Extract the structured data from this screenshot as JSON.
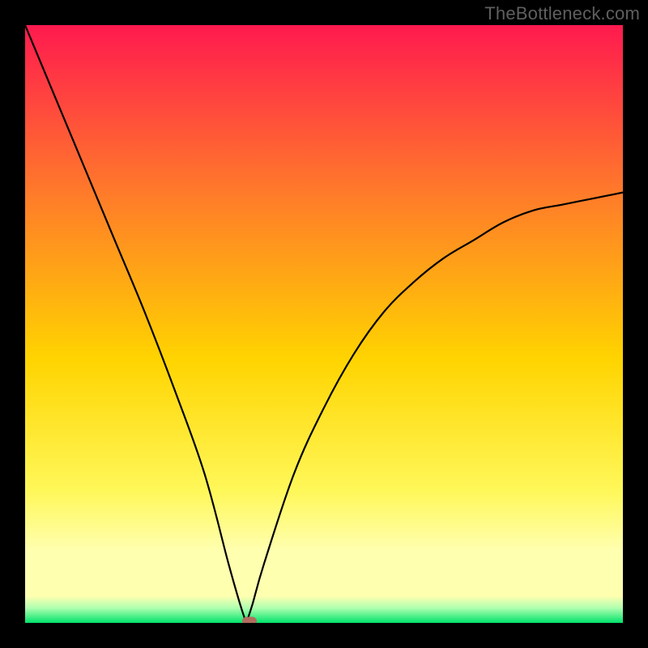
{
  "watermark": {
    "text": "TheBottleneck.com"
  },
  "colors": {
    "top": "#ff1a4f",
    "mid1": "#ff7a2a",
    "mid2": "#ffd400",
    "mid3": "#fff85a",
    "paleyellow": "#ffffb0",
    "palegreen": "#b0ffb0",
    "bottom": "#00e36b",
    "curve": "#000000",
    "marker": "#b36b5e"
  },
  "gradient_stops": [
    {
      "offset": 0.0,
      "key": "top"
    },
    {
      "offset": 0.28,
      "key": "mid1"
    },
    {
      "offset": 0.56,
      "key": "mid2"
    },
    {
      "offset": 0.78,
      "key": "mid3"
    },
    {
      "offset": 0.88,
      "key": "paleyellow"
    },
    {
      "offset": 0.955,
      "key": "paleyellow"
    },
    {
      "offset": 0.975,
      "key": "palegreen"
    },
    {
      "offset": 1.0,
      "key": "bottom"
    }
  ],
  "chart_data": {
    "type": "line",
    "title": "",
    "xlabel": "",
    "ylabel": "",
    "xlim": [
      0,
      100
    ],
    "ylim": [
      0,
      100
    ],
    "grid": false,
    "notes": "Smooth curve with a single cusp/minimum; minimum touches y=0 at x≈37; left branch starts at (0,100); right branch ends near (100,72). Gradient background encodes vertical scale (red=high, green=low). Legend absent.",
    "series": [
      {
        "name": "curve",
        "x": [
          0,
          5,
          10,
          15,
          20,
          25,
          30,
          34,
          36,
          37,
          38,
          40,
          45,
          50,
          55,
          60,
          65,
          70,
          75,
          80,
          85,
          90,
          95,
          100
        ],
        "values": [
          100,
          88,
          76,
          64,
          52,
          39,
          25,
          10,
          3,
          0,
          3,
          10,
          25,
          36,
          45,
          52,
          57,
          61,
          64,
          67,
          69,
          70,
          71,
          72
        ]
      }
    ],
    "marker": {
      "x": 37.5,
      "y": 0.3
    }
  }
}
